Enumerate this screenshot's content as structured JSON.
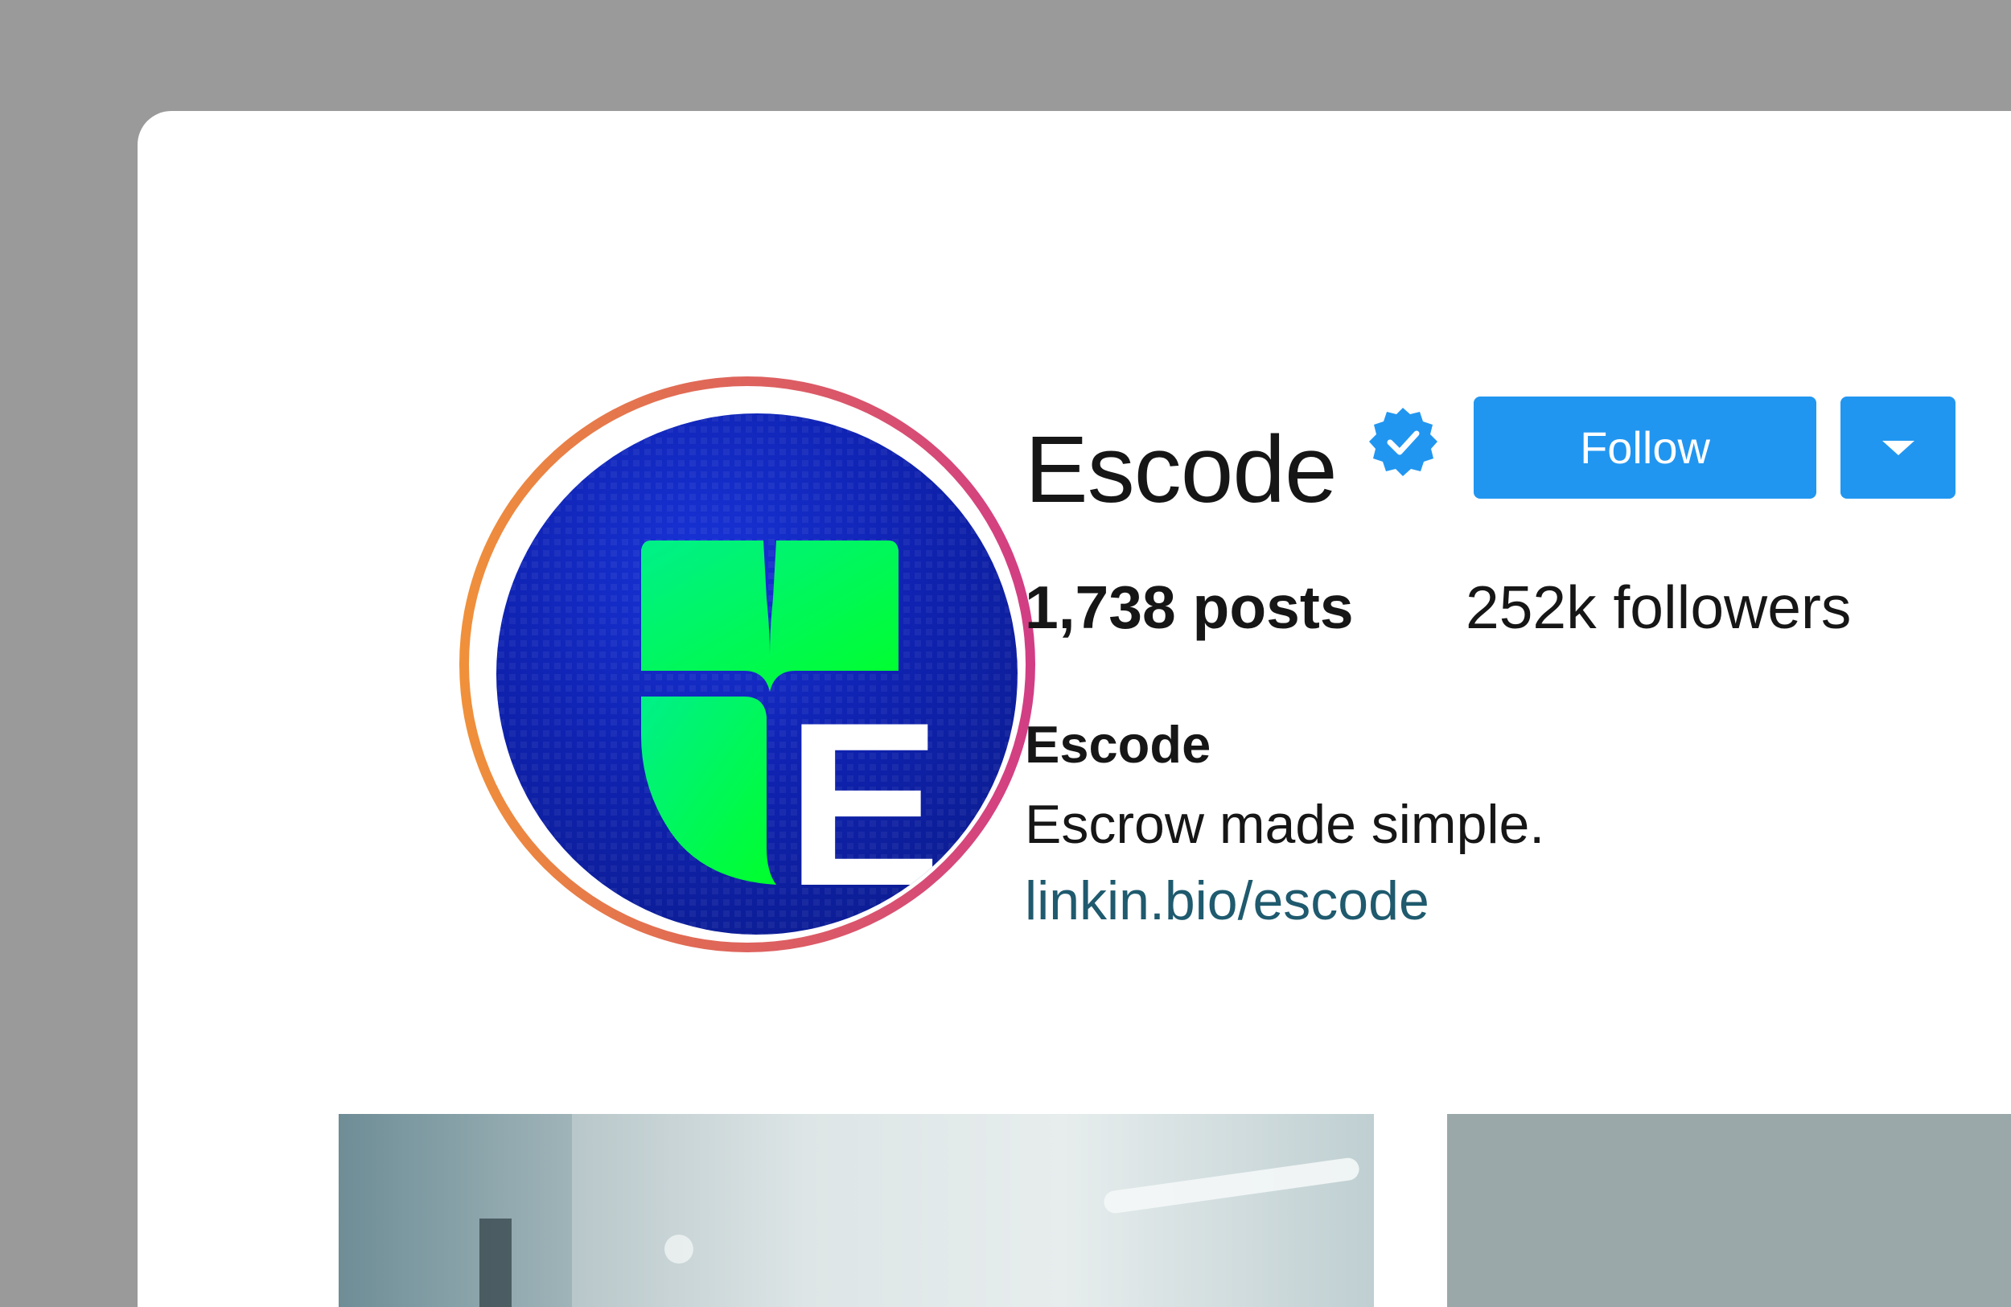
{
  "profile": {
    "username": "Escode",
    "verified": true,
    "follow_label": "Follow",
    "posts": "1,738 posts",
    "followers": "252k followers",
    "bio_name": "Escode",
    "bio_text": "Escrow made simple.",
    "bio_link": "linkin.bio/escode"
  },
  "avatar": {
    "logo_letter": "E",
    "ring_colors": [
      "#f0913a",
      "#d23d85"
    ],
    "background_color": "#0f22b0",
    "shield_color": "#00e64d"
  },
  "icons": {
    "verified": "verified-badge-icon",
    "dropdown": "chevron-down-icon"
  },
  "colors": {
    "accent": "#2196f0",
    "link": "#1f5a6e",
    "text": "#161616",
    "backdrop": "#9a9a9a"
  }
}
